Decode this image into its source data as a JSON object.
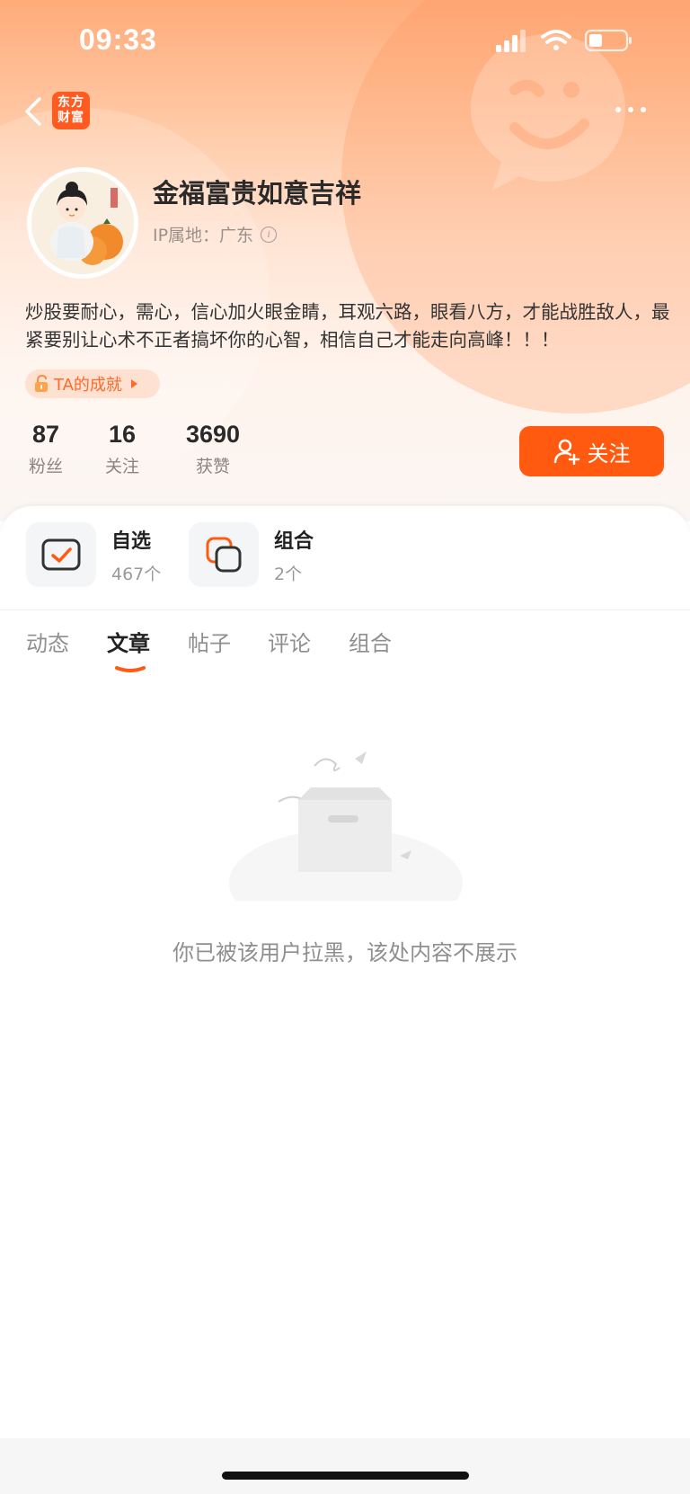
{
  "status_bar": {
    "time": "09:33"
  },
  "nav": {
    "logo_line1": "东方",
    "logo_line2": "财富"
  },
  "profile": {
    "name": "金福富贵如意吉祥",
    "ip_location": "IP属地：广东",
    "bio": "炒股要耐心，需心，信心加火眼金睛，耳观六路，眼看八方，才能战胜敌人，最紧要别让心术不正者搞坏你的心智，相信自己才能走向高峰！！！",
    "achievement_label": "TA的成就"
  },
  "stats": [
    {
      "value": "87",
      "label": "粉丝"
    },
    {
      "value": "16",
      "label": "关注"
    },
    {
      "value": "3690",
      "label": "获赞"
    }
  ],
  "follow_button": {
    "label": "关注"
  },
  "quick_links": [
    {
      "title": "自选",
      "count": "467个",
      "icon": "watchlist-check-icon"
    },
    {
      "title": "组合",
      "count": "2个",
      "icon": "portfolio-icon"
    }
  ],
  "tabs": [
    {
      "label": "动态"
    },
    {
      "label": "文章",
      "active": true
    },
    {
      "label": "帖子"
    },
    {
      "label": "评论"
    },
    {
      "label": "组合"
    }
  ],
  "empty_state": {
    "message": "你已被该用户拉黑，该处内容不展示"
  },
  "colors": {
    "accent": "#ff5a10",
    "tab_underline": "#ff5a10"
  }
}
